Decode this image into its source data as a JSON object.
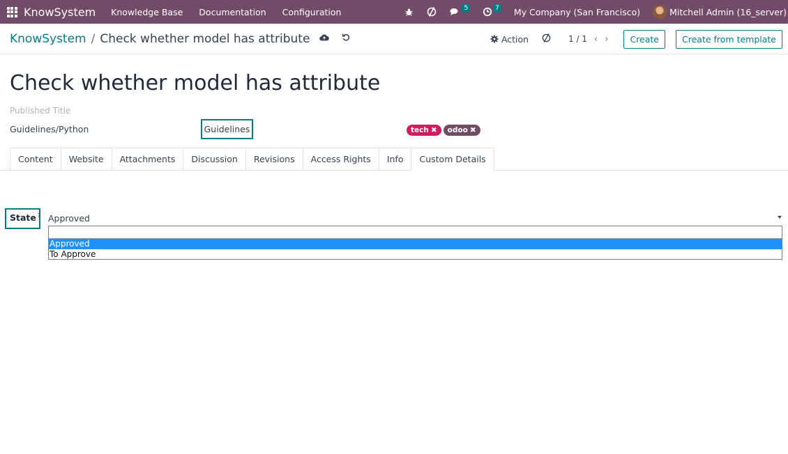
{
  "navbar": {
    "brand": "KnowSystem",
    "menus": [
      "Knowledge Base",
      "Documentation",
      "Configuration"
    ],
    "messages_count": "5",
    "activities_count": "7",
    "company": "My Company (San Francisco)",
    "user": "Mitchell Admin (16_server)"
  },
  "control": {
    "breadcrumb_root": "KnowSystem",
    "breadcrumb_sep": "/",
    "breadcrumb_current": "Check whether model has attribute",
    "action_label": "Action",
    "pager": "1 / 1",
    "create_label": "Create",
    "create_template_label": "Create from template"
  },
  "form": {
    "title": "Check whether model has attribute",
    "published_title_placeholder": "Published Title",
    "section": "Guidelines/Python",
    "tag_field": "Guidelines",
    "tags": [
      {
        "label": "tech",
        "color": "#d11a5f"
      },
      {
        "label": "odoo",
        "color": "#714B67"
      }
    ],
    "tabs": [
      "Content",
      "Website",
      "Attachments",
      "Discussion",
      "Revisions",
      "Access Rights",
      "Info",
      "Custom Details"
    ],
    "active_tab": "Custom Details",
    "state_label": "State",
    "state_help": "?",
    "state_value": "Approved",
    "state_options": [
      "Approved",
      "To Approve"
    ]
  },
  "colors": {
    "navbar": "#714B67",
    "accent": "#017e84",
    "selected_option": "#1e90ff"
  }
}
